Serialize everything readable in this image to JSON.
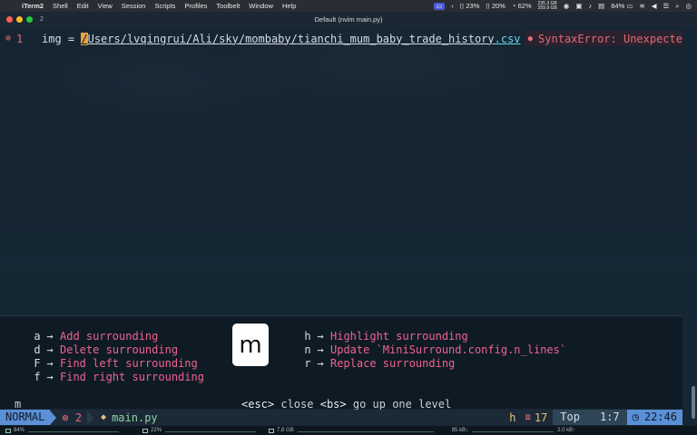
{
  "menubar": {
    "app_name": "iTerm2",
    "items": [
      "Shell",
      "Edit",
      "View",
      "Session",
      "Scripts",
      "Profiles",
      "Toolbelt",
      "Window",
      "Help"
    ],
    "cpu": "23%",
    "mem": "20%",
    "disk": "62%",
    "net_up": "235.3 GB",
    "net_down": "259.9 GB",
    "battery": "84%"
  },
  "titlebar": {
    "tab_number": "2",
    "title": "Default (nvim main.py)"
  },
  "editor": {
    "line_number": "1",
    "code_prefix": "img = ",
    "cursor_char": "/",
    "path_segments": [
      "Users",
      "lvqingrui",
      "Ali",
      "sky",
      "mombaby",
      "tianchi_mum_baby_trade_history"
    ],
    "extension": ".csv",
    "diagnostic": "SyntaxError: Unexpecte"
  },
  "clue": {
    "left": [
      {
        "key": "a",
        "desc": "Add surrounding"
      },
      {
        "key": "d",
        "desc": "Delete surrounding"
      },
      {
        "key": "F",
        "desc": "Find left surrounding"
      },
      {
        "key": "f",
        "desc": "Find right surrounding"
      }
    ],
    "right": [
      {
        "key": "h",
        "desc": "Highlight surrounding"
      },
      {
        "key": "n",
        "desc": "Update `MiniSurround.config.n_lines`"
      },
      {
        "key": "r",
        "desc": "Replace surrounding"
      }
    ],
    "logo_letter": "m",
    "footer_esc": "<esc>",
    "footer_close": "close",
    "footer_bs": "<bs>",
    "footer_up": "go up one level",
    "trigger": "m"
  },
  "statusline": {
    "mode": "NORMAL",
    "errors": "2",
    "filename": "main.py",
    "pending_key": "h",
    "count": "17",
    "scroll": "Top",
    "position": "1:7",
    "time": "22:46"
  },
  "sysbar": {
    "cpu": "84%",
    "mem": "22%",
    "disk": "7.8 GB",
    "net": "85 kB↓",
    "net2": "2.0 kB↑"
  }
}
